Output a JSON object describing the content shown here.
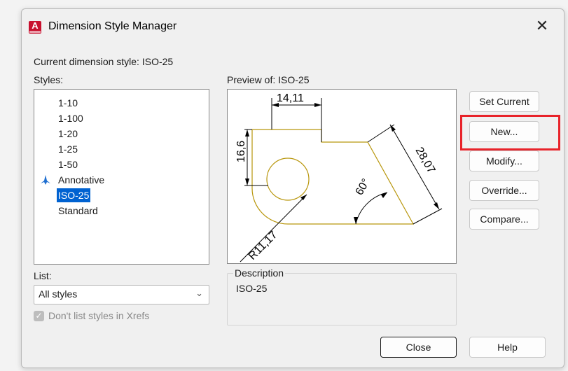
{
  "window": {
    "title": "Dimension Style Manager",
    "close_glyph": "✕",
    "app_icon": "autocad-a-icon",
    "app_icon_letter": "A"
  },
  "current_style_label": "Current dimension style: ISO-25",
  "styles_label": "Styles:",
  "styles": [
    {
      "label": "1-10"
    },
    {
      "label": "1-100"
    },
    {
      "label": "1-20"
    },
    {
      "label": "1-25"
    },
    {
      "label": "1-50"
    },
    {
      "label": "Annotative",
      "icon": "annotative-icon"
    },
    {
      "label": "ISO-25",
      "selected": true
    },
    {
      "label": "Standard"
    }
  ],
  "preview": {
    "label": "Preview of: ISO-25",
    "dims": {
      "top": "14,11",
      "left": "16,6",
      "diagonal": "28,07",
      "angle": "60°",
      "radius": "R11,17"
    }
  },
  "buttons": {
    "set_current": "Set Current",
    "new": "New...",
    "modify": "Modify...",
    "override": "Override...",
    "compare": "Compare...",
    "close": "Close",
    "help": "Help"
  },
  "list": {
    "label": "List:",
    "selected": "All styles"
  },
  "xrefs_checkbox": {
    "label": "Don't list styles in Xrefs",
    "checked": true
  },
  "description": {
    "title": "Description",
    "text": "ISO-25"
  },
  "colors": {
    "selection": "#0062d1",
    "highlight_box": "#e8232a",
    "geometry": "#b8960c"
  }
}
